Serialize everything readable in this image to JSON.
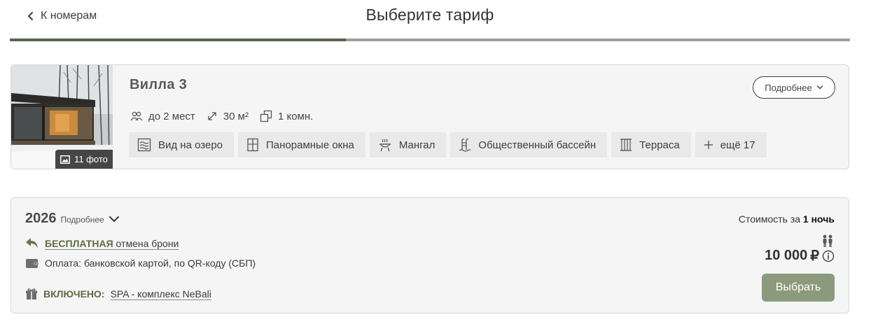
{
  "header": {
    "back_label": "К номерам",
    "title": "Выберите тариф",
    "progress_fraction": 0.4
  },
  "room": {
    "name": "Вилла 3",
    "photo_count_label": "11 фото",
    "more_label": "Подробнее",
    "specs": {
      "guests": "до 2 мест",
      "area": "30 м²",
      "rooms": "1 комн."
    },
    "amenities": [
      {
        "icon": "lake-view-icon",
        "label": "Вид на озеро"
      },
      {
        "icon": "panoramic-window-icon",
        "label": "Панорамные окна"
      },
      {
        "icon": "grill-icon",
        "label": "Мангал"
      },
      {
        "icon": "pool-ladder-icon",
        "label": "Общественный бассейн"
      },
      {
        "icon": "terrace-icon",
        "label": "Терраса"
      },
      {
        "icon": "plus-icon",
        "label": "ещё 17"
      }
    ]
  },
  "tariff": {
    "year": "2026",
    "details_label": "Подробнее",
    "cancellation_strong": "БЕСПЛАТНАЯ",
    "cancellation_rest": "отмена брони",
    "payment": "Оплата: банковской картой, по QR-коду (СБП)",
    "included_label": "ВКЛЮЧЕНО:",
    "included_value": "SPA - комплекс NeBali",
    "cost_prefix": "Стоимость за",
    "cost_period": "1 ночь",
    "price": "10 000",
    "currency": "₽",
    "select_label": "Выбрать"
  },
  "colors": {
    "accent_green": "#8c9a7c",
    "progress_dark": "#5a6251",
    "text_green": "#5c6b3e"
  }
}
